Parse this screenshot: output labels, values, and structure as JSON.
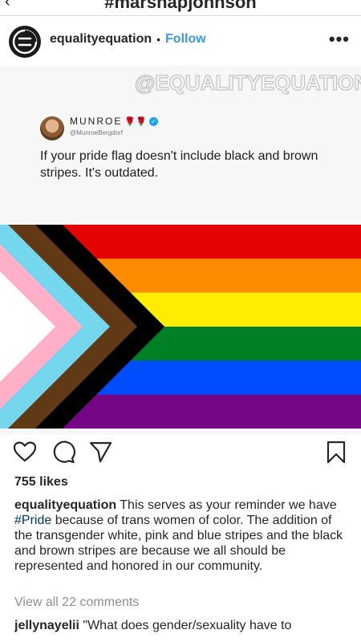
{
  "top_bar": {
    "hashtag": "#marshapjohnson",
    "back_icon": "chevron-left-icon"
  },
  "post": {
    "username": "equalityequation",
    "separator": "•",
    "follow_label": "Follow",
    "more_icon": "more-horizontal-icon",
    "more_glyph": "•••",
    "avatar_icon": "equals-logo-icon"
  },
  "image": {
    "watermark": "@EQUALITYEQUATION",
    "tweet": {
      "name": "MUNROE",
      "emoji": "🌹🌹",
      "verified_icon": "verified-badge-icon",
      "handle": "@MunroeBergdorf",
      "text": "If your pride flag doesn't include black and brown stripes. It's outdated."
    },
    "flag": {
      "stripes": [
        "#e40303",
        "#ff8c00",
        "#ffed00",
        "#008026",
        "#004dff",
        "#750787"
      ],
      "chevrons": [
        "#000000",
        "#613915",
        "#74d7ee",
        "#ffafc8",
        "#ffffff"
      ]
    }
  },
  "actions": {
    "like_icon": "heart-icon",
    "comment_icon": "comment-icon",
    "share_icon": "send-icon",
    "save_icon": "bookmark-icon"
  },
  "likes": "755 likes",
  "caption": {
    "username": "equalityequation",
    "text_before": " This serves as your reminder we have ",
    "hashtag": "#Pride",
    "text_after": " because of trans women of color. The addition of the transgender white, pink and blue stripes and the black and brown stripes are because we all should be represented and honored in our community."
  },
  "view_comments": "View all 22 comments",
  "comment": {
    "username": "jellynayelii",
    "text": " \"What does gender/sexuality have to"
  }
}
